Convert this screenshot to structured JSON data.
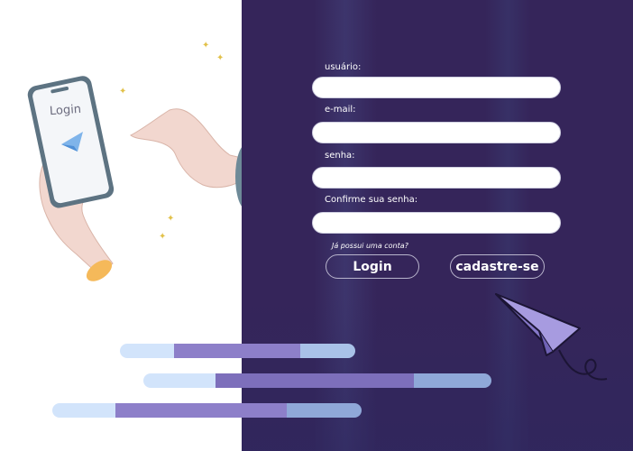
{
  "illustration": {
    "phone_title": "Login",
    "icons": [
      "phone-icon",
      "paper-boat-icon",
      "hand-icon",
      "sparkle-icon",
      "paper-plane-icon"
    ]
  },
  "form": {
    "username_label": "usuário:",
    "email_label": "e-mail:",
    "password_label": "senha:",
    "confirm_label": "Confirme sua senha:",
    "username_value": "",
    "email_value": "",
    "password_value": "",
    "confirm_value": "",
    "already_text": "Já possui uma conta?",
    "login_button": "Login",
    "signup_button": "cadastre-se"
  },
  "colors": {
    "dark_panel": "#35255a",
    "accent_purple": "#8d7fc9",
    "light_blue": "#cfe3fb",
    "sparkle": "#e2c14a"
  }
}
